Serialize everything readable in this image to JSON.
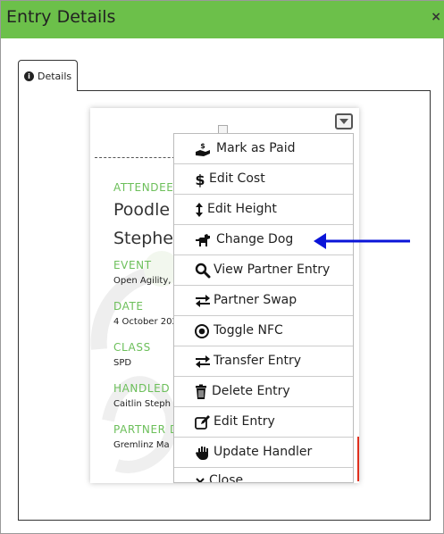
{
  "dialog": {
    "title": "Entry Details",
    "close_glyph": "×"
  },
  "tabs": [
    {
      "label": "Details",
      "icon": "info-icon"
    }
  ],
  "entry": {
    "attendee_label": "ATTENDEE",
    "dog_name": "Poodle",
    "handler_name": "Stephe",
    "event_label": "EVENT",
    "event_value": "Open Agility,",
    "date_label": "DATE",
    "date_value": "4 October 202",
    "class_label": "CLASS",
    "class_value": "SPD",
    "handled_label": "HANDLED",
    "handled_value": "Caitlin Steph",
    "partner_label": "PARTNER D",
    "partner_value": "Gremlinz Ma"
  },
  "menu": {
    "items": [
      {
        "label": "Mark as Paid",
        "icon": "hand-holding-dollar-icon"
      },
      {
        "label": "Edit Cost",
        "icon": "dollar-icon"
      },
      {
        "label": "Edit Height",
        "icon": "arrows-vertical-icon"
      },
      {
        "label": "Change Dog",
        "icon": "dog-icon"
      },
      {
        "label": "View Partner Entry",
        "icon": "search-icon"
      },
      {
        "label": "Partner Swap",
        "icon": "exchange-icon"
      },
      {
        "label": "Toggle NFC",
        "icon": "radio-dot-icon"
      },
      {
        "label": "Transfer Entry",
        "icon": "exchange-icon"
      },
      {
        "label": "Delete Entry",
        "icon": "trash-icon"
      },
      {
        "label": "Edit Entry",
        "icon": "edit-icon"
      },
      {
        "label": "Update Handler",
        "icon": "hand-icon"
      },
      {
        "label": "Close",
        "icon": "close-icon"
      }
    ]
  },
  "colors": {
    "header_bg": "#6cc04a",
    "label_green": "#6cbf5a",
    "arrow_blue": "#0a14d8"
  }
}
